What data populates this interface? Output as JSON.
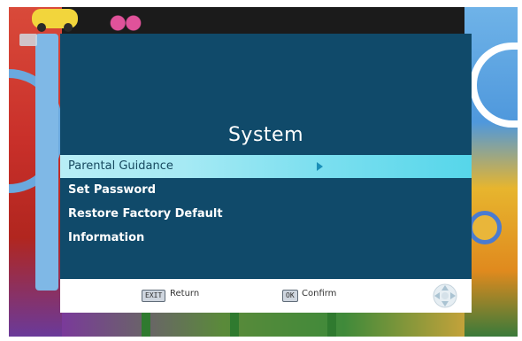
{
  "menu": {
    "title": "System",
    "items": [
      {
        "label": "Parental Guidance",
        "selected": true,
        "has_submenu": true
      },
      {
        "label": "Set Password",
        "selected": false
      },
      {
        "label": "Restore Factory Default",
        "selected": false
      },
      {
        "label": "Information",
        "selected": false
      }
    ]
  },
  "help_bar": {
    "return_key": "EXIT",
    "return_label": "Return",
    "confirm_key": "OK",
    "confirm_label": "Confirm",
    "nav_icon": "directional-pad-icon"
  },
  "colors": {
    "panel_bg": "#104a6a",
    "highlight": "#7fe0f0",
    "text": "#ffffff"
  }
}
